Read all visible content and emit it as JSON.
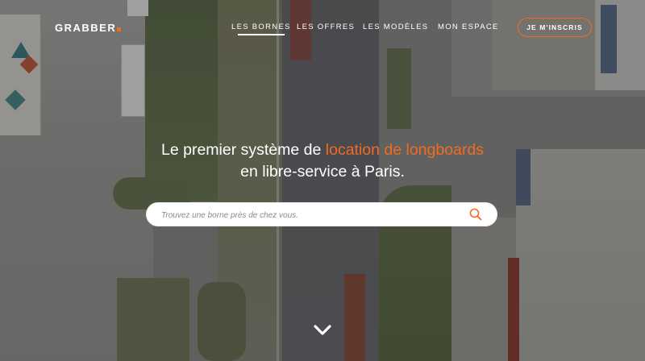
{
  "brand": {
    "name": "GRABBER",
    "accent_color": "#f26b21"
  },
  "nav": {
    "items": [
      {
        "label": "LES BORNES",
        "active": true
      },
      {
        "label": "LES OFFRES",
        "active": false
      },
      {
        "label": "LES MODÈLES",
        "active": false
      },
      {
        "label": "MON ESPACE",
        "active": false
      }
    ],
    "cta_label": "JE M'INSCRIS"
  },
  "hero": {
    "headline_part1": "Le premier système de ",
    "headline_accent": "location de longboards",
    "headline_part2": "en libre-service à Paris."
  },
  "search": {
    "placeholder": "Trouvez une borne près de chez vous.",
    "value": ""
  },
  "icons": {
    "search": "search-icon",
    "scroll": "chevron-down-icon"
  }
}
